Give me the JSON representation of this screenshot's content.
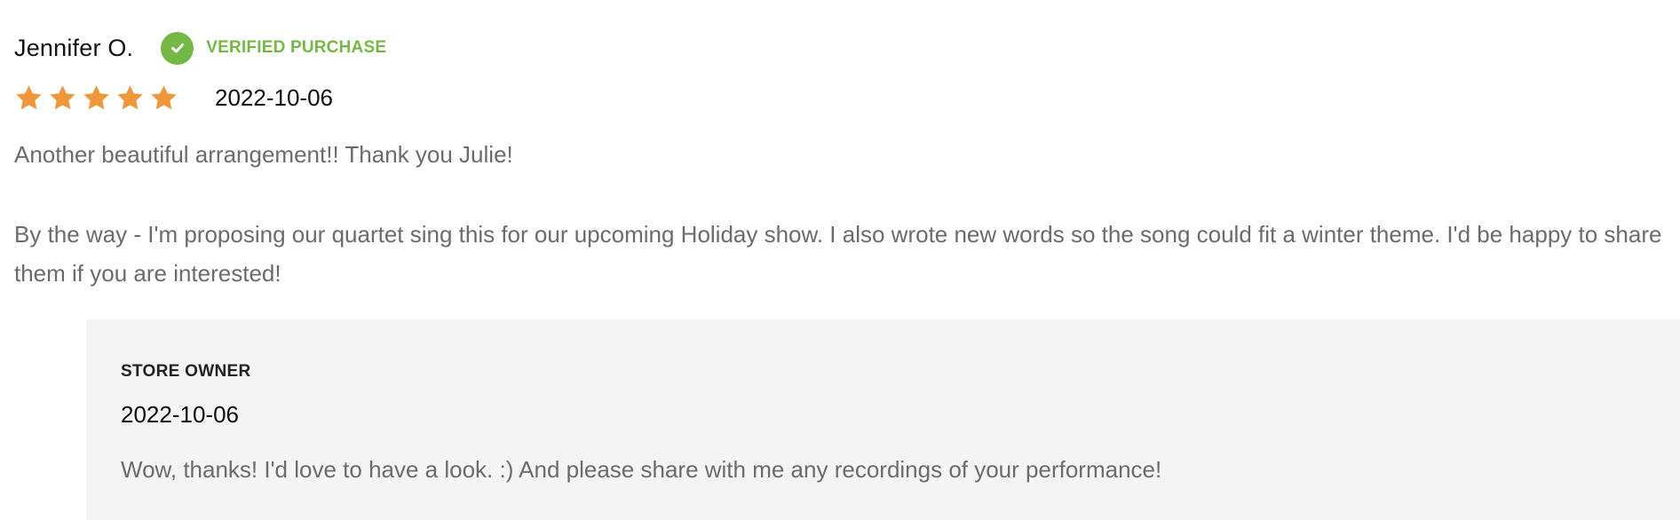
{
  "review": {
    "reviewer_name": "Jennifer O.",
    "verified_label": "VERIFIED PURCHASE",
    "rating": 5,
    "max_rating": 5,
    "date": "2022-10-06",
    "paragraphs": [
      "Another beautiful arrangement!! Thank you Julie!",
      "By the way - I'm proposing our quartet sing this for our upcoming Holiday show. I also wrote new words so the song could fit a winter theme. I'd be happy to share them if you are interested!"
    ]
  },
  "owner_reply": {
    "label": "STORE OWNER",
    "date": "2022-10-06",
    "text": "Wow, thanks! I'd love to have a look. :) And please share with me any recordings of your performance!"
  },
  "colors": {
    "star": "#f0973b",
    "verified": "#73b845",
    "body_text": "#6b6b6b",
    "reply_background": "#f4f4f4"
  },
  "icons": {
    "verified": "check-circle-icon",
    "star": "star-icon"
  }
}
